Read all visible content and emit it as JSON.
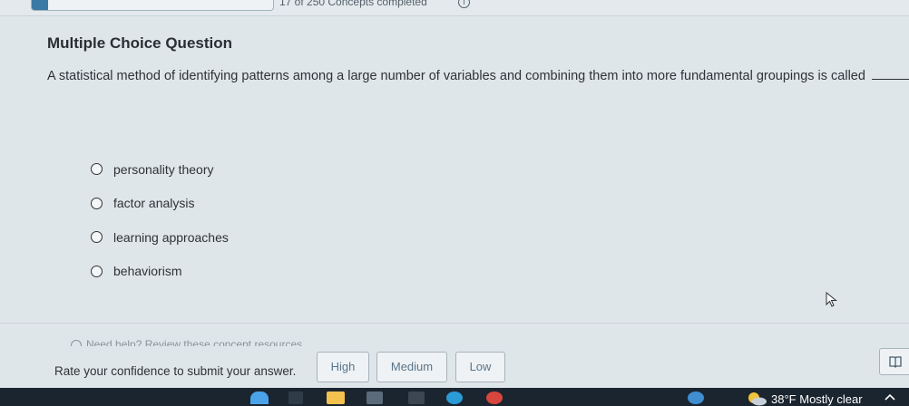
{
  "progress": {
    "text": "17 of 250 Concepts completed",
    "fraction": 0.068
  },
  "question": {
    "heading": "Multiple Choice Question",
    "text": "A statistical method of identifying patterns among a large number of variables and combining them into more fundamental groupings is called"
  },
  "options": [
    {
      "label": "personality theory"
    },
    {
      "label": "factor analysis"
    },
    {
      "label": "learning approaches"
    },
    {
      "label": "behaviorism"
    }
  ],
  "help": {
    "text": "Need help? Review these concept resources."
  },
  "confidence": {
    "label": "Rate your confidence to submit your answer.",
    "high": "High",
    "medium": "Medium",
    "low": "Low"
  },
  "taskbar": {
    "weather_temp": "38°F",
    "weather_desc": "Mostly clear"
  },
  "icons": {
    "info": "info-icon",
    "cursor": "mouse-pointer-icon",
    "reader": "book-icon",
    "help": "help-circle-icon",
    "weather": "moon-cloud-icon",
    "chevron": "chevron-up-icon"
  },
  "colors": {
    "accent": "#3b79a6",
    "background": "#dfe6ea",
    "taskbar": "#1b2530"
  }
}
